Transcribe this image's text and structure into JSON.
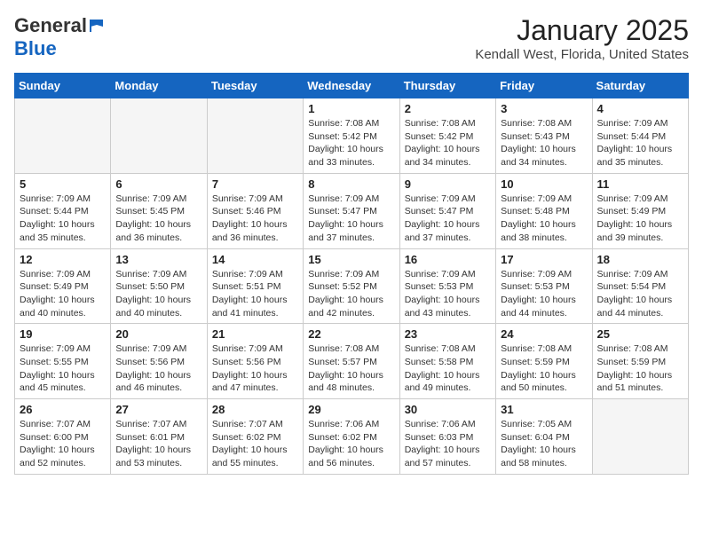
{
  "header": {
    "logo_general": "General",
    "logo_blue": "Blue",
    "month_title": "January 2025",
    "location": "Kendall West, Florida, United States"
  },
  "weekdays": [
    "Sunday",
    "Monday",
    "Tuesday",
    "Wednesday",
    "Thursday",
    "Friday",
    "Saturday"
  ],
  "weeks": [
    [
      {
        "day": "",
        "empty": true
      },
      {
        "day": "",
        "empty": true
      },
      {
        "day": "",
        "empty": true
      },
      {
        "day": "1",
        "sunrise": "Sunrise: 7:08 AM",
        "sunset": "Sunset: 5:42 PM",
        "daylight": "Daylight: 10 hours and 33 minutes."
      },
      {
        "day": "2",
        "sunrise": "Sunrise: 7:08 AM",
        "sunset": "Sunset: 5:42 PM",
        "daylight": "Daylight: 10 hours and 34 minutes."
      },
      {
        "day": "3",
        "sunrise": "Sunrise: 7:08 AM",
        "sunset": "Sunset: 5:43 PM",
        "daylight": "Daylight: 10 hours and 34 minutes."
      },
      {
        "day": "4",
        "sunrise": "Sunrise: 7:09 AM",
        "sunset": "Sunset: 5:44 PM",
        "daylight": "Daylight: 10 hours and 35 minutes."
      }
    ],
    [
      {
        "day": "5",
        "sunrise": "Sunrise: 7:09 AM",
        "sunset": "Sunset: 5:44 PM",
        "daylight": "Daylight: 10 hours and 35 minutes."
      },
      {
        "day": "6",
        "sunrise": "Sunrise: 7:09 AM",
        "sunset": "Sunset: 5:45 PM",
        "daylight": "Daylight: 10 hours and 36 minutes."
      },
      {
        "day": "7",
        "sunrise": "Sunrise: 7:09 AM",
        "sunset": "Sunset: 5:46 PM",
        "daylight": "Daylight: 10 hours and 36 minutes."
      },
      {
        "day": "8",
        "sunrise": "Sunrise: 7:09 AM",
        "sunset": "Sunset: 5:47 PM",
        "daylight": "Daylight: 10 hours and 37 minutes."
      },
      {
        "day": "9",
        "sunrise": "Sunrise: 7:09 AM",
        "sunset": "Sunset: 5:47 PM",
        "daylight": "Daylight: 10 hours and 37 minutes."
      },
      {
        "day": "10",
        "sunrise": "Sunrise: 7:09 AM",
        "sunset": "Sunset: 5:48 PM",
        "daylight": "Daylight: 10 hours and 38 minutes."
      },
      {
        "day": "11",
        "sunrise": "Sunrise: 7:09 AM",
        "sunset": "Sunset: 5:49 PM",
        "daylight": "Daylight: 10 hours and 39 minutes."
      }
    ],
    [
      {
        "day": "12",
        "sunrise": "Sunrise: 7:09 AM",
        "sunset": "Sunset: 5:49 PM",
        "daylight": "Daylight: 10 hours and 40 minutes."
      },
      {
        "day": "13",
        "sunrise": "Sunrise: 7:09 AM",
        "sunset": "Sunset: 5:50 PM",
        "daylight": "Daylight: 10 hours and 40 minutes."
      },
      {
        "day": "14",
        "sunrise": "Sunrise: 7:09 AM",
        "sunset": "Sunset: 5:51 PM",
        "daylight": "Daylight: 10 hours and 41 minutes."
      },
      {
        "day": "15",
        "sunrise": "Sunrise: 7:09 AM",
        "sunset": "Sunset: 5:52 PM",
        "daylight": "Daylight: 10 hours and 42 minutes."
      },
      {
        "day": "16",
        "sunrise": "Sunrise: 7:09 AM",
        "sunset": "Sunset: 5:53 PM",
        "daylight": "Daylight: 10 hours and 43 minutes."
      },
      {
        "day": "17",
        "sunrise": "Sunrise: 7:09 AM",
        "sunset": "Sunset: 5:53 PM",
        "daylight": "Daylight: 10 hours and 44 minutes."
      },
      {
        "day": "18",
        "sunrise": "Sunrise: 7:09 AM",
        "sunset": "Sunset: 5:54 PM",
        "daylight": "Daylight: 10 hours and 44 minutes."
      }
    ],
    [
      {
        "day": "19",
        "sunrise": "Sunrise: 7:09 AM",
        "sunset": "Sunset: 5:55 PM",
        "daylight": "Daylight: 10 hours and 45 minutes."
      },
      {
        "day": "20",
        "sunrise": "Sunrise: 7:09 AM",
        "sunset": "Sunset: 5:56 PM",
        "daylight": "Daylight: 10 hours and 46 minutes."
      },
      {
        "day": "21",
        "sunrise": "Sunrise: 7:09 AM",
        "sunset": "Sunset: 5:56 PM",
        "daylight": "Daylight: 10 hours and 47 minutes."
      },
      {
        "day": "22",
        "sunrise": "Sunrise: 7:08 AM",
        "sunset": "Sunset: 5:57 PM",
        "daylight": "Daylight: 10 hours and 48 minutes."
      },
      {
        "day": "23",
        "sunrise": "Sunrise: 7:08 AM",
        "sunset": "Sunset: 5:58 PM",
        "daylight": "Daylight: 10 hours and 49 minutes."
      },
      {
        "day": "24",
        "sunrise": "Sunrise: 7:08 AM",
        "sunset": "Sunset: 5:59 PM",
        "daylight": "Daylight: 10 hours and 50 minutes."
      },
      {
        "day": "25",
        "sunrise": "Sunrise: 7:08 AM",
        "sunset": "Sunset: 5:59 PM",
        "daylight": "Daylight: 10 hours and 51 minutes."
      }
    ],
    [
      {
        "day": "26",
        "sunrise": "Sunrise: 7:07 AM",
        "sunset": "Sunset: 6:00 PM",
        "daylight": "Daylight: 10 hours and 52 minutes."
      },
      {
        "day": "27",
        "sunrise": "Sunrise: 7:07 AM",
        "sunset": "Sunset: 6:01 PM",
        "daylight": "Daylight: 10 hours and 53 minutes."
      },
      {
        "day": "28",
        "sunrise": "Sunrise: 7:07 AM",
        "sunset": "Sunset: 6:02 PM",
        "daylight": "Daylight: 10 hours and 55 minutes."
      },
      {
        "day": "29",
        "sunrise": "Sunrise: 7:06 AM",
        "sunset": "Sunset: 6:02 PM",
        "daylight": "Daylight: 10 hours and 56 minutes."
      },
      {
        "day": "30",
        "sunrise": "Sunrise: 7:06 AM",
        "sunset": "Sunset: 6:03 PM",
        "daylight": "Daylight: 10 hours and 57 minutes."
      },
      {
        "day": "31",
        "sunrise": "Sunrise: 7:05 AM",
        "sunset": "Sunset: 6:04 PM",
        "daylight": "Daylight: 10 hours and 58 minutes."
      },
      {
        "day": "",
        "empty": true
      }
    ]
  ]
}
